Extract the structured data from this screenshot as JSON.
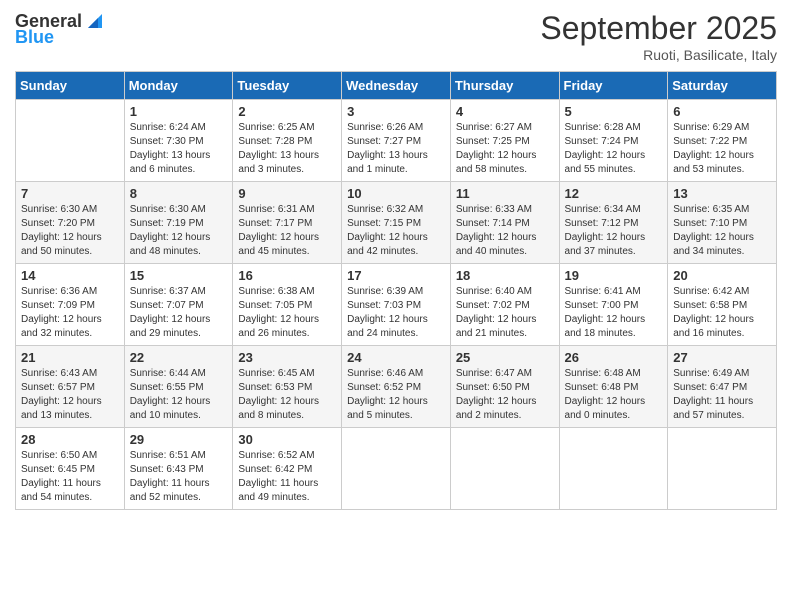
{
  "header": {
    "logo_general": "General",
    "logo_blue": "Blue",
    "month_title": "September 2025",
    "location": "Ruoti, Basilicate, Italy"
  },
  "days_of_week": [
    "Sunday",
    "Monday",
    "Tuesday",
    "Wednesday",
    "Thursday",
    "Friday",
    "Saturday"
  ],
  "weeks": [
    [
      {
        "day": "",
        "content": ""
      },
      {
        "day": "1",
        "content": "Sunrise: 6:24 AM\nSunset: 7:30 PM\nDaylight: 13 hours\nand 6 minutes."
      },
      {
        "day": "2",
        "content": "Sunrise: 6:25 AM\nSunset: 7:28 PM\nDaylight: 13 hours\nand 3 minutes."
      },
      {
        "day": "3",
        "content": "Sunrise: 6:26 AM\nSunset: 7:27 PM\nDaylight: 13 hours\nand 1 minute."
      },
      {
        "day": "4",
        "content": "Sunrise: 6:27 AM\nSunset: 7:25 PM\nDaylight: 12 hours\nand 58 minutes."
      },
      {
        "day": "5",
        "content": "Sunrise: 6:28 AM\nSunset: 7:24 PM\nDaylight: 12 hours\nand 55 minutes."
      },
      {
        "day": "6",
        "content": "Sunrise: 6:29 AM\nSunset: 7:22 PM\nDaylight: 12 hours\nand 53 minutes."
      }
    ],
    [
      {
        "day": "7",
        "content": "Sunrise: 6:30 AM\nSunset: 7:20 PM\nDaylight: 12 hours\nand 50 minutes."
      },
      {
        "day": "8",
        "content": "Sunrise: 6:30 AM\nSunset: 7:19 PM\nDaylight: 12 hours\nand 48 minutes."
      },
      {
        "day": "9",
        "content": "Sunrise: 6:31 AM\nSunset: 7:17 PM\nDaylight: 12 hours\nand 45 minutes."
      },
      {
        "day": "10",
        "content": "Sunrise: 6:32 AM\nSunset: 7:15 PM\nDaylight: 12 hours\nand 42 minutes."
      },
      {
        "day": "11",
        "content": "Sunrise: 6:33 AM\nSunset: 7:14 PM\nDaylight: 12 hours\nand 40 minutes."
      },
      {
        "day": "12",
        "content": "Sunrise: 6:34 AM\nSunset: 7:12 PM\nDaylight: 12 hours\nand 37 minutes."
      },
      {
        "day": "13",
        "content": "Sunrise: 6:35 AM\nSunset: 7:10 PM\nDaylight: 12 hours\nand 34 minutes."
      }
    ],
    [
      {
        "day": "14",
        "content": "Sunrise: 6:36 AM\nSunset: 7:09 PM\nDaylight: 12 hours\nand 32 minutes."
      },
      {
        "day": "15",
        "content": "Sunrise: 6:37 AM\nSunset: 7:07 PM\nDaylight: 12 hours\nand 29 minutes."
      },
      {
        "day": "16",
        "content": "Sunrise: 6:38 AM\nSunset: 7:05 PM\nDaylight: 12 hours\nand 26 minutes."
      },
      {
        "day": "17",
        "content": "Sunrise: 6:39 AM\nSunset: 7:03 PM\nDaylight: 12 hours\nand 24 minutes."
      },
      {
        "day": "18",
        "content": "Sunrise: 6:40 AM\nSunset: 7:02 PM\nDaylight: 12 hours\nand 21 minutes."
      },
      {
        "day": "19",
        "content": "Sunrise: 6:41 AM\nSunset: 7:00 PM\nDaylight: 12 hours\nand 18 minutes."
      },
      {
        "day": "20",
        "content": "Sunrise: 6:42 AM\nSunset: 6:58 PM\nDaylight: 12 hours\nand 16 minutes."
      }
    ],
    [
      {
        "day": "21",
        "content": "Sunrise: 6:43 AM\nSunset: 6:57 PM\nDaylight: 12 hours\nand 13 minutes."
      },
      {
        "day": "22",
        "content": "Sunrise: 6:44 AM\nSunset: 6:55 PM\nDaylight: 12 hours\nand 10 minutes."
      },
      {
        "day": "23",
        "content": "Sunrise: 6:45 AM\nSunset: 6:53 PM\nDaylight: 12 hours\nand 8 minutes."
      },
      {
        "day": "24",
        "content": "Sunrise: 6:46 AM\nSunset: 6:52 PM\nDaylight: 12 hours\nand 5 minutes."
      },
      {
        "day": "25",
        "content": "Sunrise: 6:47 AM\nSunset: 6:50 PM\nDaylight: 12 hours\nand 2 minutes."
      },
      {
        "day": "26",
        "content": "Sunrise: 6:48 AM\nSunset: 6:48 PM\nDaylight: 12 hours\nand 0 minutes."
      },
      {
        "day": "27",
        "content": "Sunrise: 6:49 AM\nSunset: 6:47 PM\nDaylight: 11 hours\nand 57 minutes."
      }
    ],
    [
      {
        "day": "28",
        "content": "Sunrise: 6:50 AM\nSunset: 6:45 PM\nDaylight: 11 hours\nand 54 minutes."
      },
      {
        "day": "29",
        "content": "Sunrise: 6:51 AM\nSunset: 6:43 PM\nDaylight: 11 hours\nand 52 minutes."
      },
      {
        "day": "30",
        "content": "Sunrise: 6:52 AM\nSunset: 6:42 PM\nDaylight: 11 hours\nand 49 minutes."
      },
      {
        "day": "",
        "content": ""
      },
      {
        "day": "",
        "content": ""
      },
      {
        "day": "",
        "content": ""
      },
      {
        "day": "",
        "content": ""
      }
    ]
  ]
}
